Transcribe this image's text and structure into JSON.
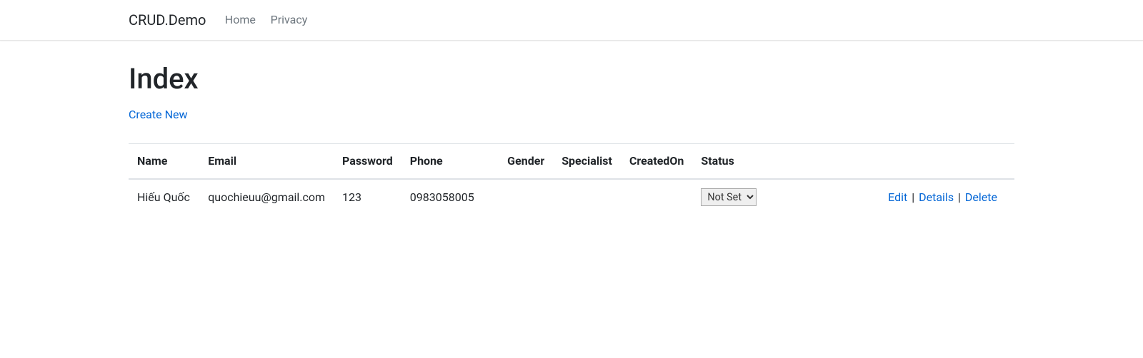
{
  "nav": {
    "brand": "CRUD.Demo",
    "links": {
      "home": "Home",
      "privacy": "Privacy"
    }
  },
  "page": {
    "title": "Index",
    "create_link": "Create New"
  },
  "table": {
    "headers": {
      "name": "Name",
      "email": "Email",
      "password": "Password",
      "phone": "Phone",
      "gender": "Gender",
      "specialist": "Specialist",
      "createdon": "CreatedOn",
      "status": "Status"
    },
    "rows": [
      {
        "name": "Hiếu Quốc",
        "email": "quochieuu@gmail.com",
        "password": "123",
        "phone": "0983058005",
        "gender": "",
        "specialist": "",
        "createdon": "",
        "status": "Not Set"
      }
    ],
    "actions": {
      "edit": "Edit",
      "details": "Details",
      "delete": "Delete"
    }
  }
}
